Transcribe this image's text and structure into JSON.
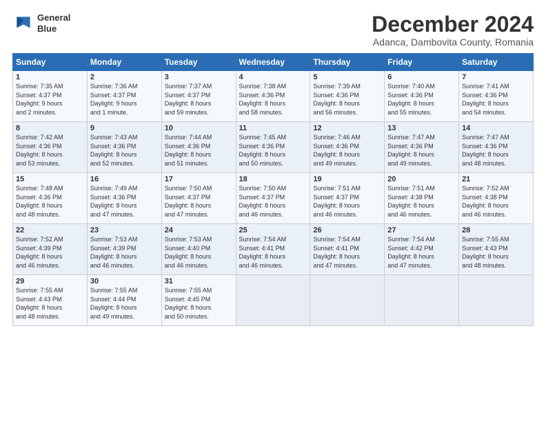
{
  "logo": {
    "line1": "General",
    "line2": "Blue"
  },
  "title": "December 2024",
  "subtitle": "Adanca, Dambovita County, Romania",
  "days_of_week": [
    "Sunday",
    "Monday",
    "Tuesday",
    "Wednesday",
    "Thursday",
    "Friday",
    "Saturday"
  ],
  "weeks": [
    [
      {
        "day": "1",
        "info": "Sunrise: 7:35 AM\nSunset: 4:37 PM\nDaylight: 9 hours\nand 2 minutes."
      },
      {
        "day": "2",
        "info": "Sunrise: 7:36 AM\nSunset: 4:37 PM\nDaylight: 9 hours\nand 1 minute."
      },
      {
        "day": "3",
        "info": "Sunrise: 7:37 AM\nSunset: 4:37 PM\nDaylight: 8 hours\nand 59 minutes."
      },
      {
        "day": "4",
        "info": "Sunrise: 7:38 AM\nSunset: 4:36 PM\nDaylight: 8 hours\nand 58 minutes."
      },
      {
        "day": "5",
        "info": "Sunrise: 7:39 AM\nSunset: 4:36 PM\nDaylight: 8 hours\nand 56 minutes."
      },
      {
        "day": "6",
        "info": "Sunrise: 7:40 AM\nSunset: 4:36 PM\nDaylight: 8 hours\nand 55 minutes."
      },
      {
        "day": "7",
        "info": "Sunrise: 7:41 AM\nSunset: 4:36 PM\nDaylight: 8 hours\nand 54 minutes."
      }
    ],
    [
      {
        "day": "8",
        "info": "Sunrise: 7:42 AM\nSunset: 4:36 PM\nDaylight: 8 hours\nand 53 minutes."
      },
      {
        "day": "9",
        "info": "Sunrise: 7:43 AM\nSunset: 4:36 PM\nDaylight: 8 hours\nand 52 minutes."
      },
      {
        "day": "10",
        "info": "Sunrise: 7:44 AM\nSunset: 4:36 PM\nDaylight: 8 hours\nand 51 minutes."
      },
      {
        "day": "11",
        "info": "Sunrise: 7:45 AM\nSunset: 4:36 PM\nDaylight: 8 hours\nand 50 minutes."
      },
      {
        "day": "12",
        "info": "Sunrise: 7:46 AM\nSunset: 4:36 PM\nDaylight: 8 hours\nand 49 minutes."
      },
      {
        "day": "13",
        "info": "Sunrise: 7:47 AM\nSunset: 4:36 PM\nDaylight: 8 hours\nand 49 minutes."
      },
      {
        "day": "14",
        "info": "Sunrise: 7:47 AM\nSunset: 4:36 PM\nDaylight: 8 hours\nand 48 minutes."
      }
    ],
    [
      {
        "day": "15",
        "info": "Sunrise: 7:48 AM\nSunset: 4:36 PM\nDaylight: 8 hours\nand 48 minutes."
      },
      {
        "day": "16",
        "info": "Sunrise: 7:49 AM\nSunset: 4:36 PM\nDaylight: 8 hours\nand 47 minutes."
      },
      {
        "day": "17",
        "info": "Sunrise: 7:50 AM\nSunset: 4:37 PM\nDaylight: 8 hours\nand 47 minutes."
      },
      {
        "day": "18",
        "info": "Sunrise: 7:50 AM\nSunset: 4:37 PM\nDaylight: 8 hours\nand 46 minutes."
      },
      {
        "day": "19",
        "info": "Sunrise: 7:51 AM\nSunset: 4:37 PM\nDaylight: 8 hours\nand 46 minutes."
      },
      {
        "day": "20",
        "info": "Sunrise: 7:51 AM\nSunset: 4:38 PM\nDaylight: 8 hours\nand 46 minutes."
      },
      {
        "day": "21",
        "info": "Sunrise: 7:52 AM\nSunset: 4:38 PM\nDaylight: 8 hours\nand 46 minutes."
      }
    ],
    [
      {
        "day": "22",
        "info": "Sunrise: 7:52 AM\nSunset: 4:39 PM\nDaylight: 8 hours\nand 46 minutes."
      },
      {
        "day": "23",
        "info": "Sunrise: 7:53 AM\nSunset: 4:39 PM\nDaylight: 8 hours\nand 46 minutes."
      },
      {
        "day": "24",
        "info": "Sunrise: 7:53 AM\nSunset: 4:40 PM\nDaylight: 8 hours\nand 46 minutes."
      },
      {
        "day": "25",
        "info": "Sunrise: 7:54 AM\nSunset: 4:41 PM\nDaylight: 8 hours\nand 46 minutes."
      },
      {
        "day": "26",
        "info": "Sunrise: 7:54 AM\nSunset: 4:41 PM\nDaylight: 8 hours\nand 47 minutes."
      },
      {
        "day": "27",
        "info": "Sunrise: 7:54 AM\nSunset: 4:42 PM\nDaylight: 8 hours\nand 47 minutes."
      },
      {
        "day": "28",
        "info": "Sunrise: 7:55 AM\nSunset: 4:43 PM\nDaylight: 8 hours\nand 48 minutes."
      }
    ],
    [
      {
        "day": "29",
        "info": "Sunrise: 7:55 AM\nSunset: 4:43 PM\nDaylight: 8 hours\nand 48 minutes."
      },
      {
        "day": "30",
        "info": "Sunrise: 7:55 AM\nSunset: 4:44 PM\nDaylight: 8 hours\nand 49 minutes."
      },
      {
        "day": "31",
        "info": "Sunrise: 7:55 AM\nSunset: 4:45 PM\nDaylight: 8 hours\nand 50 minutes."
      },
      null,
      null,
      null,
      null
    ]
  ]
}
